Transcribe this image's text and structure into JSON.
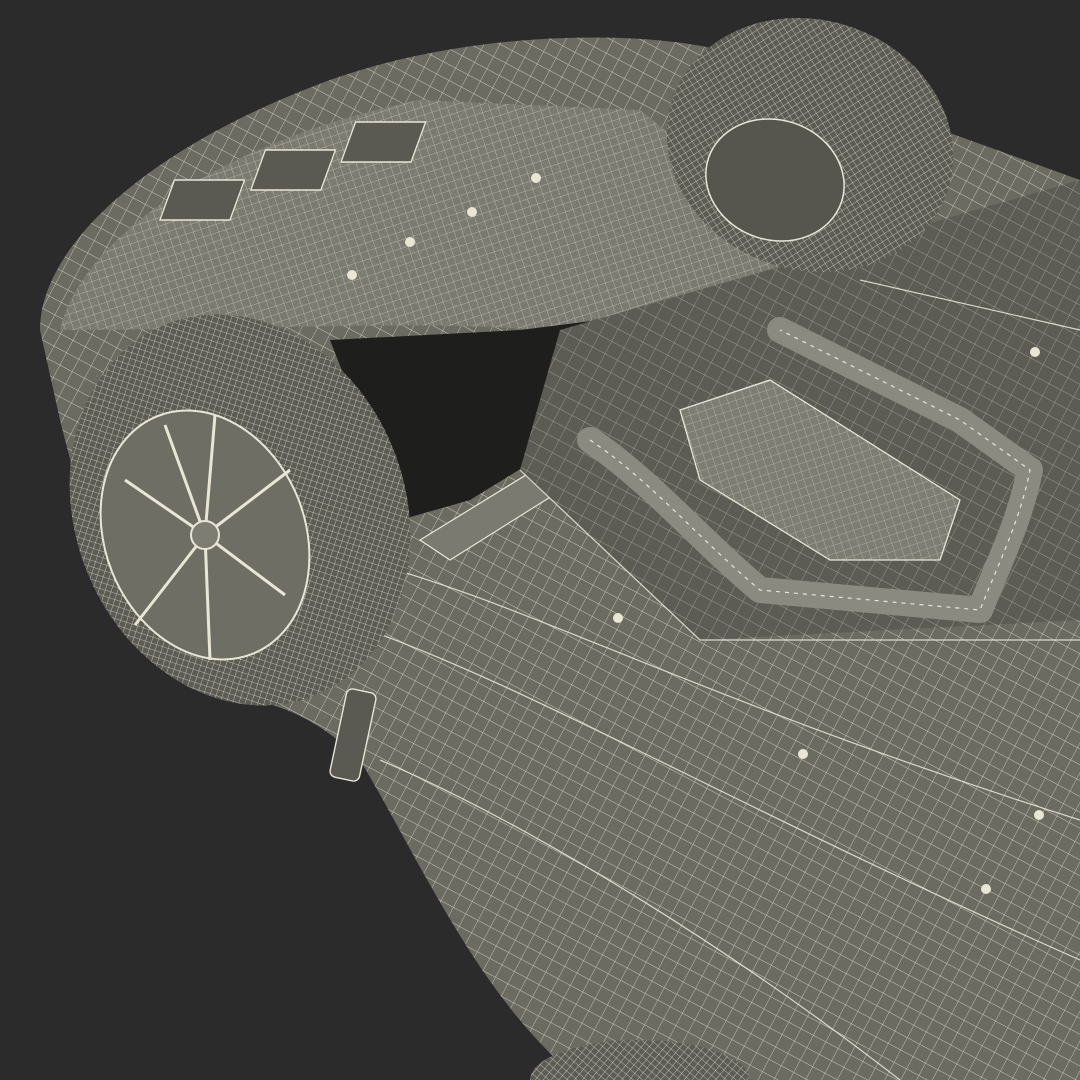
{
  "scene": {
    "subject": "car-underbody-wireframe",
    "colors": {
      "background": "#2b2b2b",
      "body_shade": "#6b6b62",
      "body_light": "#7d7d73",
      "body_dark": "#565650",
      "wire": "#e9e6d6",
      "shadow": "#1e1e1c",
      "tire": "#5c5c55"
    }
  }
}
